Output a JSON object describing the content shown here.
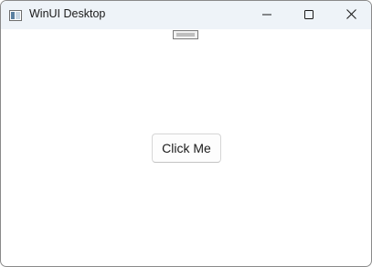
{
  "window": {
    "title": "WinUI Desktop"
  },
  "caption_buttons": {
    "minimize_icon": "minimize-icon",
    "maximize_icon": "maximize-icon",
    "close_icon": "close-icon"
  },
  "content": {
    "button_label": "Click Me"
  },
  "colors": {
    "titlebar_bg": "#eef3f8",
    "window_bg": "#ffffff",
    "button_bg": "#fdfdfd",
    "text": "#1a1a1a"
  }
}
